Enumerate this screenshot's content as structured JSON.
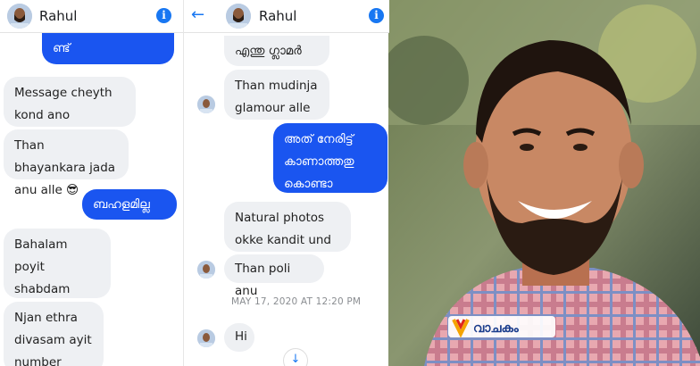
{
  "left_chat": {
    "contact_name": "Rahul",
    "messages": [
      {
        "dir": "out",
        "text": "ണ്ട്"
      },
      {
        "dir": "in",
        "text": "Message cheyth kond ano"
      },
      {
        "dir": "in",
        "text": "Than bhayankara jada anu alle 😎"
      },
      {
        "dir": "out",
        "text": "ബഹളമില്ല"
      },
      {
        "dir": "in",
        "text": "Bahalam poyit shabdam polumilla"
      },
      {
        "dir": "in",
        "text": "Njan ethra divasam ayit number"
      }
    ]
  },
  "right_chat": {
    "contact_name": "Rahul",
    "back_icon": "back-arrow-icon",
    "messages": [
      {
        "dir": "in",
        "text": "എന്തു ഗ്ലാമർ"
      },
      {
        "dir": "in",
        "text": "Than mudinja glamour alle"
      },
      {
        "dir": "out",
        "text": "അത് നേരിട്ട് കാണാത്തതു കൊണ്ടാ"
      },
      {
        "dir": "in",
        "text": "Natural photos okke kandit und"
      },
      {
        "dir": "in",
        "text": "Than poli anu"
      },
      {
        "dir": "in",
        "text": "Hi"
      }
    ],
    "timestamp": "MAY 17, 2020 AT 12:20 PM"
  },
  "photo": {
    "description_icon": "portrait-photo",
    "watermark": "വാചകം"
  },
  "colors": {
    "messenger_blue": "#1a55f0",
    "incoming_bubble": "#eef0f3",
    "info_blue": "#1877f2"
  }
}
